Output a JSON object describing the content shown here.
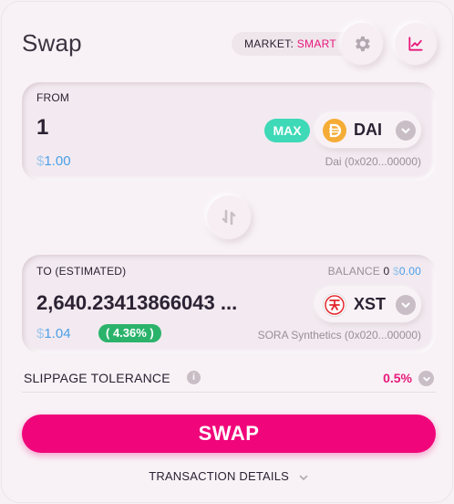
{
  "header": {
    "title": "Swap",
    "market_label": "MARKET:",
    "market_value": "SMART"
  },
  "from": {
    "label": "FROM",
    "amount": "1",
    "fiat_symbol": "$",
    "fiat_value": "1.00",
    "max_label": "MAX",
    "token_symbol": "DAI",
    "token_address": "Dai (0x020...00000)",
    "token_icon": "dai-icon"
  },
  "to": {
    "label": "TO (ESTIMATED)",
    "balance_label": "BALANCE",
    "balance_value": "0",
    "balance_fiat_symbol": "$",
    "balance_fiat_value": "0.00",
    "amount": "2,640.23413866043 ...",
    "fiat_symbol": "$",
    "fiat_value": "1.04",
    "price_impact": "( 4.36% )",
    "token_symbol": "XST",
    "token_address": "SORA Synthetics (0x020...00000)",
    "token_icon": "xst-icon"
  },
  "slippage": {
    "label": "SLIPPAGE TOLERANCE",
    "value": "0.5%"
  },
  "actions": {
    "swap_label": "SWAP",
    "details_label": "TRANSACTION DETAILS"
  },
  "colors": {
    "accent": "#f0067a",
    "max": "#3ed9b7",
    "impact": "#2bb36b",
    "fiat": "#4a9fe8"
  },
  "icons": [
    "gear-icon",
    "chart-icon",
    "swap-direction-icon",
    "chevron-down-icon",
    "info-icon"
  ]
}
